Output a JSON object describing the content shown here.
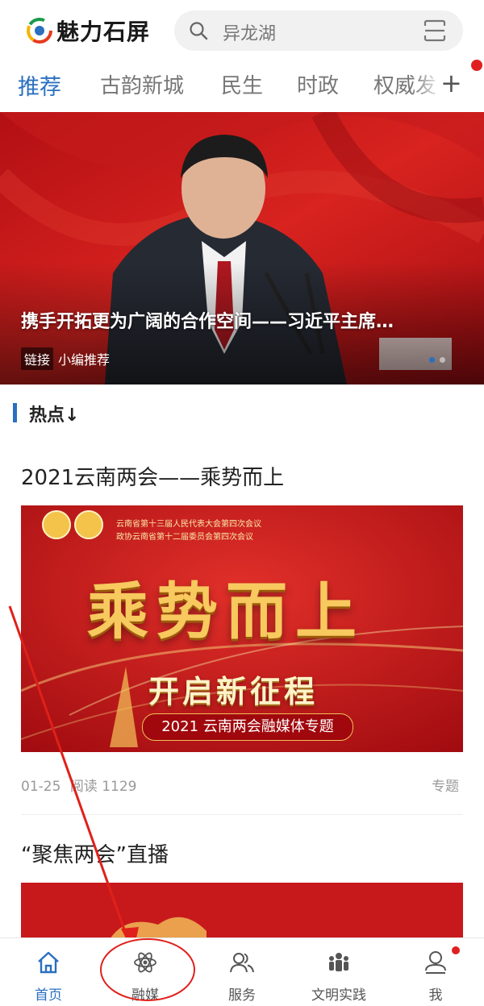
{
  "app": {
    "logo_text": "魅力石屏",
    "logo_icon": "app-logo-icon"
  },
  "search": {
    "placeholder": "异龙湖",
    "icon": "search-icon",
    "scan_icon": "scan-icon"
  },
  "tabs": [
    {
      "label": "推荐",
      "active": true
    },
    {
      "label": "古韵新城"
    },
    {
      "label": "民生"
    },
    {
      "label": "时政"
    },
    {
      "label": "权威发"
    }
  ],
  "tabs_add": "+",
  "hero": {
    "caption": "携手开拓更为广阔的合作空间——习近平主席…",
    "tag": "链接",
    "source": "小编推荐"
  },
  "section": {
    "title": "热点↓"
  },
  "articles": [
    {
      "title": "2021云南两会——乘势而上",
      "banner": {
        "line1": "云南省第十三届人民代表大会第四次会议",
        "line2": "政协云南省第十二届委员会第四次会议",
        "headline": "乘势而上",
        "sub": "开启新征程",
        "ribbon": "2021 云南两会融媒体专题"
      },
      "date": "01-25",
      "reads": "阅读 1129",
      "type": "专题"
    },
    {
      "title": "“聚焦两会”直播"
    }
  ],
  "nav": [
    {
      "label": "首页",
      "icon": "home-icon",
      "active": true
    },
    {
      "label": "融媒",
      "icon": "atom-icon"
    },
    {
      "label": "服务",
      "icon": "users-icon"
    },
    {
      "label": "文明实践",
      "icon": "group-icon"
    },
    {
      "label": "我",
      "icon": "profile-icon",
      "badge": true
    }
  ],
  "colors": {
    "accent": "#2a6fc0",
    "brand_red": "#c8151b",
    "badge_red": "#e02020"
  }
}
